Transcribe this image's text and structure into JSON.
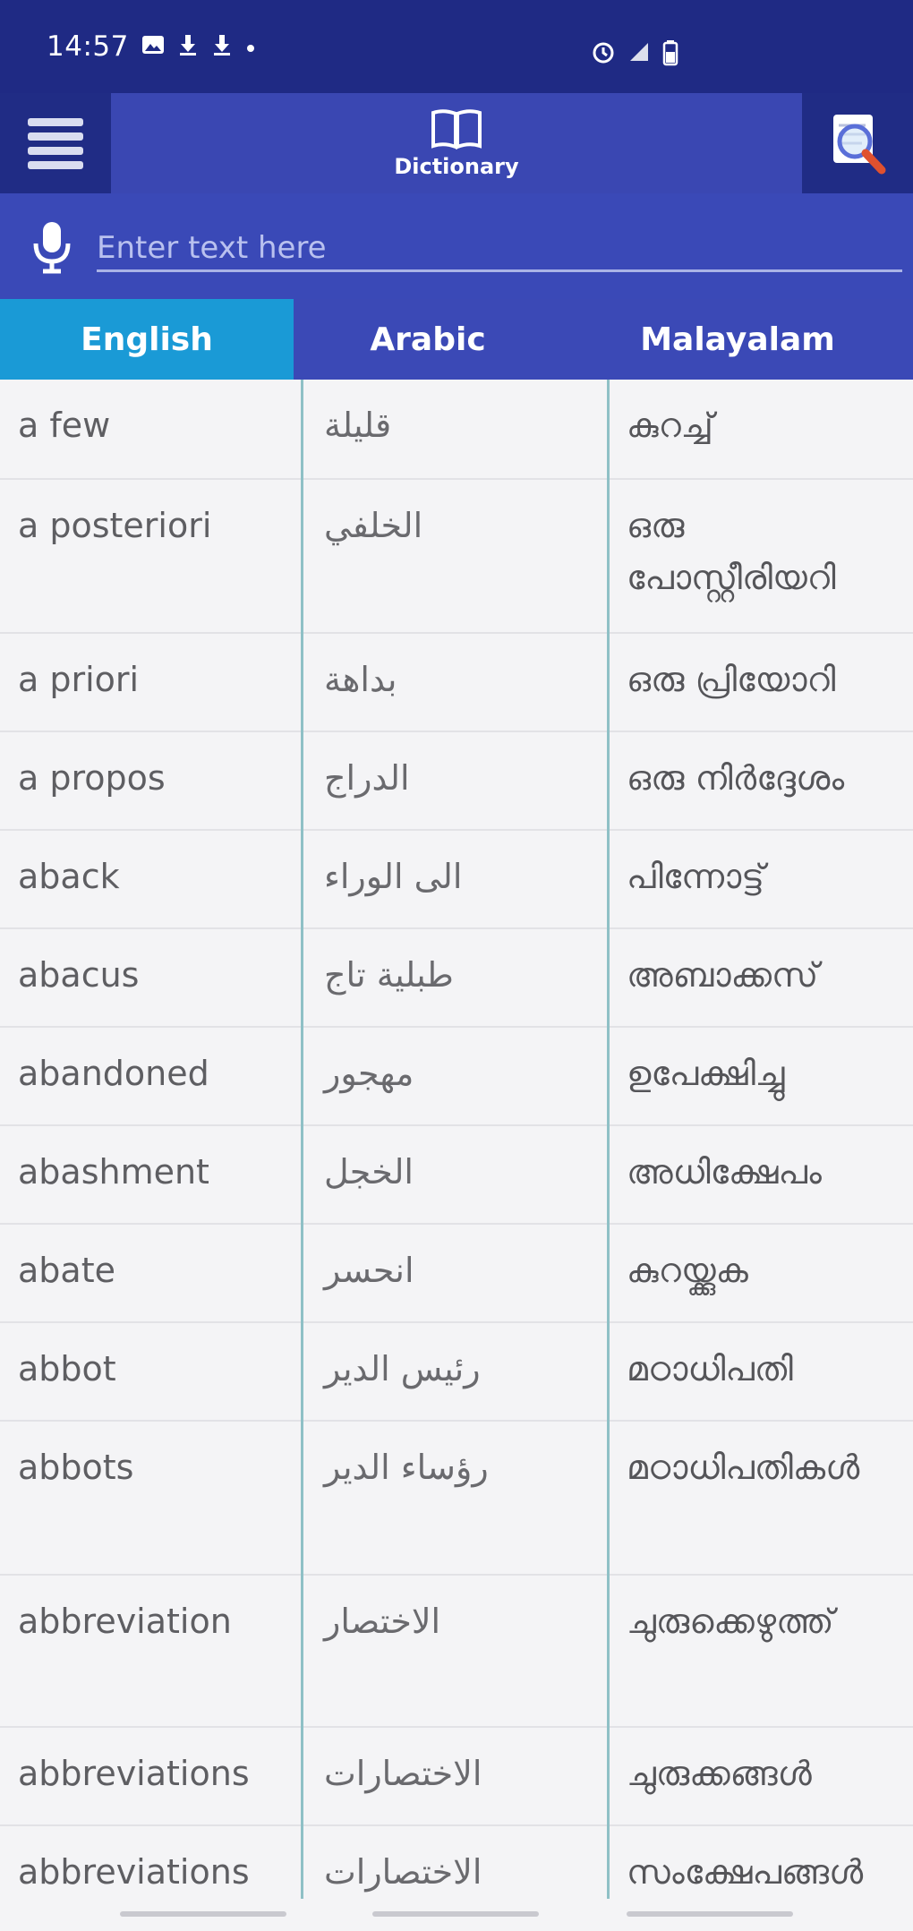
{
  "status_bar": {
    "time": "14:57",
    "left_icons": [
      "gallery-icon",
      "download-icon",
      "download-icon",
      "dot-icon"
    ],
    "right_icons": [
      "alarm-icon",
      "signal-icon",
      "battery-icon"
    ]
  },
  "app_bar": {
    "menu_icon": "hamburger-menu-icon",
    "tab_label": "Dictionary",
    "tab_icon": "book-icon",
    "search_icon": "magnifier-icon"
  },
  "search": {
    "placeholder": "Enter text here",
    "value": ""
  },
  "languages": [
    {
      "label": "English",
      "active": true
    },
    {
      "label": "Arabic",
      "active": false
    },
    {
      "label": "Malayalam",
      "active": false
    }
  ],
  "rows": [
    {
      "en": "a few",
      "ar": "قليلة",
      "ml": "കുറച്ച്"
    },
    {
      "en": "a posteriori",
      "ar": "الخلفي",
      "ml": "ഒരു പോസ്റ്റീരിയറി"
    },
    {
      "en": "a priori",
      "ar": "بداهة",
      "ml": "ഒരു പ്രിയോറി"
    },
    {
      "en": "a propos",
      "ar": "الدراج",
      "ml": "ഒരു നിർദ്ദേശം"
    },
    {
      "en": "aback",
      "ar": "الى الوراء",
      "ml": "പിന്നോട്ട്"
    },
    {
      "en": "abacus",
      "ar": "طبلية تاج",
      "ml": "അബാക്കസ്"
    },
    {
      "en": "abandoned",
      "ar": "مهجور",
      "ml": "ഉപേക്ഷിച്ചു"
    },
    {
      "en": "abashment",
      "ar": "الخجل",
      "ml": "അധിക്ഷേപം"
    },
    {
      "en": "abate",
      "ar": "انحسر",
      "ml": "കുറയ്ക്കുക"
    },
    {
      "en": "abbot",
      "ar": "رئيس الدير",
      "ml": "മഠാധിപതി"
    },
    {
      "en": "abbots",
      "ar": "رؤساء الدير",
      "ml": "മഠാധിപതികൾ"
    },
    {
      "en": "abbreviation",
      "ar": "الاختصار",
      "ml": "ചുരുക്കെഴുത്ത്"
    },
    {
      "en": "abbreviations",
      "ar": "الاختصارات",
      "ml": "ചുരുക്കങ്ങൾ"
    },
    {
      "en": "abbreviations",
      "ar": "الاختصارات",
      "ml": "സംക്ഷേപങ്ങൾ"
    }
  ]
}
